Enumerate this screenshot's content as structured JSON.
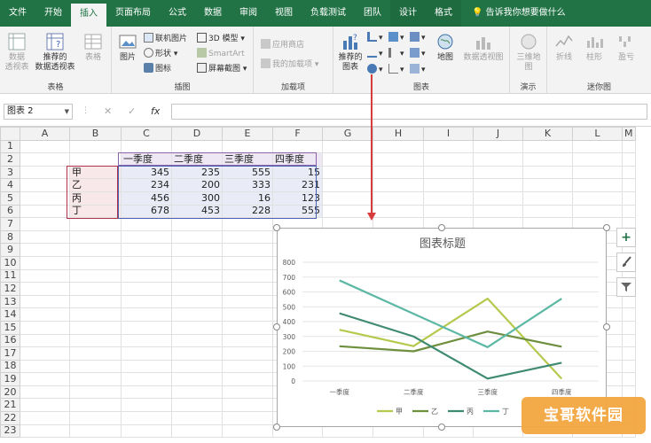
{
  "tabs": [
    "文件",
    "开始",
    "插入",
    "页面布局",
    "公式",
    "数据",
    "审阅",
    "视图",
    "负载测试",
    "团队",
    "设计",
    "格式"
  ],
  "tell_me": "告诉我你想要做什么",
  "ribbon": {
    "tables": {
      "label": "表格",
      "pivot": "数据\n透视表",
      "rec_pivot": "推荐的\n数据透视表",
      "table": "表格"
    },
    "illustrations": {
      "label": "插图",
      "picture": "图片",
      "online_picture": "联机图片",
      "shapes": "形状",
      "icons": "图标",
      "model3d": "3D 模型",
      "smartart": "SmartArt",
      "screenshot": "屏幕截图"
    },
    "addins": {
      "label": "加载项",
      "store": "应用商店",
      "my_addins": "我的加载项"
    },
    "charts": {
      "label": "图表",
      "rec_charts": "推荐的\n图表",
      "map": "地图",
      "pivot_chart": "数据透视图"
    },
    "tours": {
      "label": "演示",
      "map3d": "三维地\n图"
    },
    "sparklines": {
      "label": "迷你图",
      "line": "折线",
      "column": "柱形",
      "winloss": "盈亏"
    }
  },
  "formula_bar": {
    "name_box": "图表 2",
    "cancel": "✕",
    "enter": "✓",
    "fx": "fx",
    "value": ""
  },
  "columns": [
    "A",
    "B",
    "C",
    "D",
    "E",
    "F",
    "G",
    "H",
    "I",
    "J",
    "K",
    "L",
    "M"
  ],
  "rows": [
    "1",
    "2",
    "3",
    "4",
    "5",
    "6",
    "7",
    "8",
    "9",
    "10",
    "11",
    "12",
    "13",
    "14",
    "15",
    "16",
    "17",
    "18",
    "19",
    "20",
    "21",
    "22",
    "23"
  ],
  "table": {
    "headers": [
      "一季度",
      "二季度",
      "三季度",
      "四季度"
    ],
    "rows": [
      {
        "label": "甲",
        "values": [
          "345",
          "235",
          "555",
          "15"
        ]
      },
      {
        "label": "乙",
        "values": [
          "234",
          "200",
          "333",
          "231"
        ]
      },
      {
        "label": "丙",
        "values": [
          "456",
          "300",
          "16",
          "123"
        ]
      },
      {
        "label": "丁",
        "values": [
          "678",
          "453",
          "228",
          "555"
        ]
      }
    ]
  },
  "chart_data": {
    "type": "line",
    "title": "图表标题",
    "categories": [
      "一季度",
      "二季度",
      "三季度",
      "四季度"
    ],
    "series": [
      {
        "name": "甲",
        "values": [
          345,
          235,
          555,
          15
        ],
        "color": "#b5c94d"
      },
      {
        "name": "乙",
        "values": [
          234,
          200,
          333,
          231
        ],
        "color": "#6e8f3e"
      },
      {
        "name": "丙",
        "values": [
          456,
          300,
          16,
          123
        ],
        "color": "#3f8a72"
      },
      {
        "name": "丁",
        "values": [
          678,
          453,
          228,
          555
        ],
        "color": "#5cb8a4"
      }
    ],
    "ylim": [
      0,
      800
    ],
    "yticks": [
      "0",
      "100",
      "200",
      "300",
      "400",
      "500",
      "600",
      "700",
      "800"
    ],
    "grid": true,
    "legend": "bottom"
  },
  "watermark": "宝哥软件园",
  "colors": {
    "accent": "#217346",
    "arrow": "#d83b3b"
  }
}
